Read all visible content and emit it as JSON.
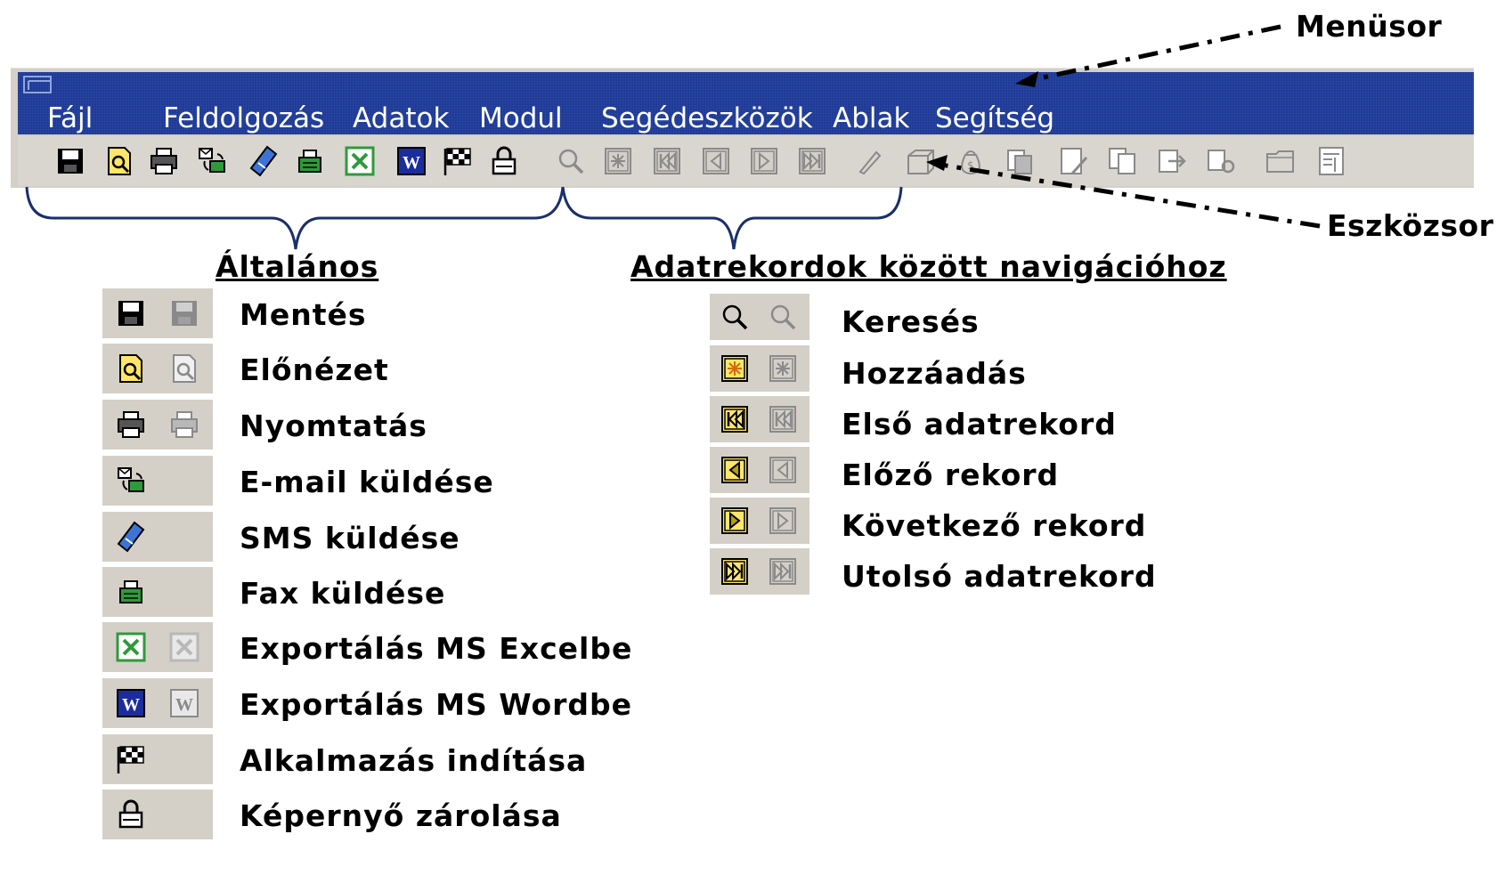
{
  "menubar": {
    "items": [
      {
        "label": "Fájl"
      },
      {
        "label": "Feldolgozás"
      },
      {
        "label": "Adatok"
      },
      {
        "label": "Modul"
      },
      {
        "label": "Segédeszközök"
      },
      {
        "label": "Ablak"
      },
      {
        "label": "Segítség"
      }
    ]
  },
  "toolbar": {
    "icons": [
      "save-icon",
      "preview-icon",
      "print-icon",
      "email-icon",
      "sms-icon",
      "fax-icon",
      "excel-icon",
      "word-icon",
      "checkered-flag-icon",
      "lock-icon",
      "search-icon",
      "add-record-icon",
      "first-record-icon",
      "previous-record-icon",
      "next-record-icon",
      "last-record-icon",
      "pencil-icon",
      "box-icon",
      "moneybag-icon",
      "document-stack-icon",
      "document-edit-icon",
      "copy-icon",
      "transfer-icon",
      "settings-icon",
      "folder-icon",
      "report-icon"
    ]
  },
  "callouts": {
    "menusor": "Menüsor",
    "eszkozsor": "Eszközsor"
  },
  "groups": {
    "general": "Általános",
    "navigation": "Adatrekordok között navigációhoz"
  },
  "legend_general": [
    {
      "icon": "save-icon",
      "label": "Mentés",
      "has_disabled": true
    },
    {
      "icon": "preview-icon",
      "label": "Előnézet",
      "has_disabled": true
    },
    {
      "icon": "print-icon",
      "label": "Nyomtatás",
      "has_disabled": true
    },
    {
      "icon": "email-icon",
      "label": "E-mail küldése",
      "has_disabled": false
    },
    {
      "icon": "sms-icon",
      "label": "SMS küldése",
      "has_disabled": false
    },
    {
      "icon": "fax-icon",
      "label": "Fax küldése",
      "has_disabled": false
    },
    {
      "icon": "excel-icon",
      "label": "Exportálás MS Excelbe",
      "has_disabled": true
    },
    {
      "icon": "word-icon",
      "label": "Exportálás MS Wordbe",
      "has_disabled": true
    },
    {
      "icon": "checkered-flag-icon",
      "label": "Alkalmazás indítása",
      "has_disabled": false
    },
    {
      "icon": "lock-icon",
      "label": "Képernyő zárolása",
      "has_disabled": false
    }
  ],
  "legend_navigation": [
    {
      "icon": "search-icon",
      "label": "Keresés"
    },
    {
      "icon": "add-record-icon",
      "label": "Hozzáadás"
    },
    {
      "icon": "first-record-icon",
      "label": "Első adatrekord"
    },
    {
      "icon": "previous-record-icon",
      "label": "Előző rekord"
    },
    {
      "icon": "next-record-icon",
      "label": "Következő rekord"
    },
    {
      "icon": "last-record-icon",
      "label": "Utolsó adatrekord"
    }
  ]
}
